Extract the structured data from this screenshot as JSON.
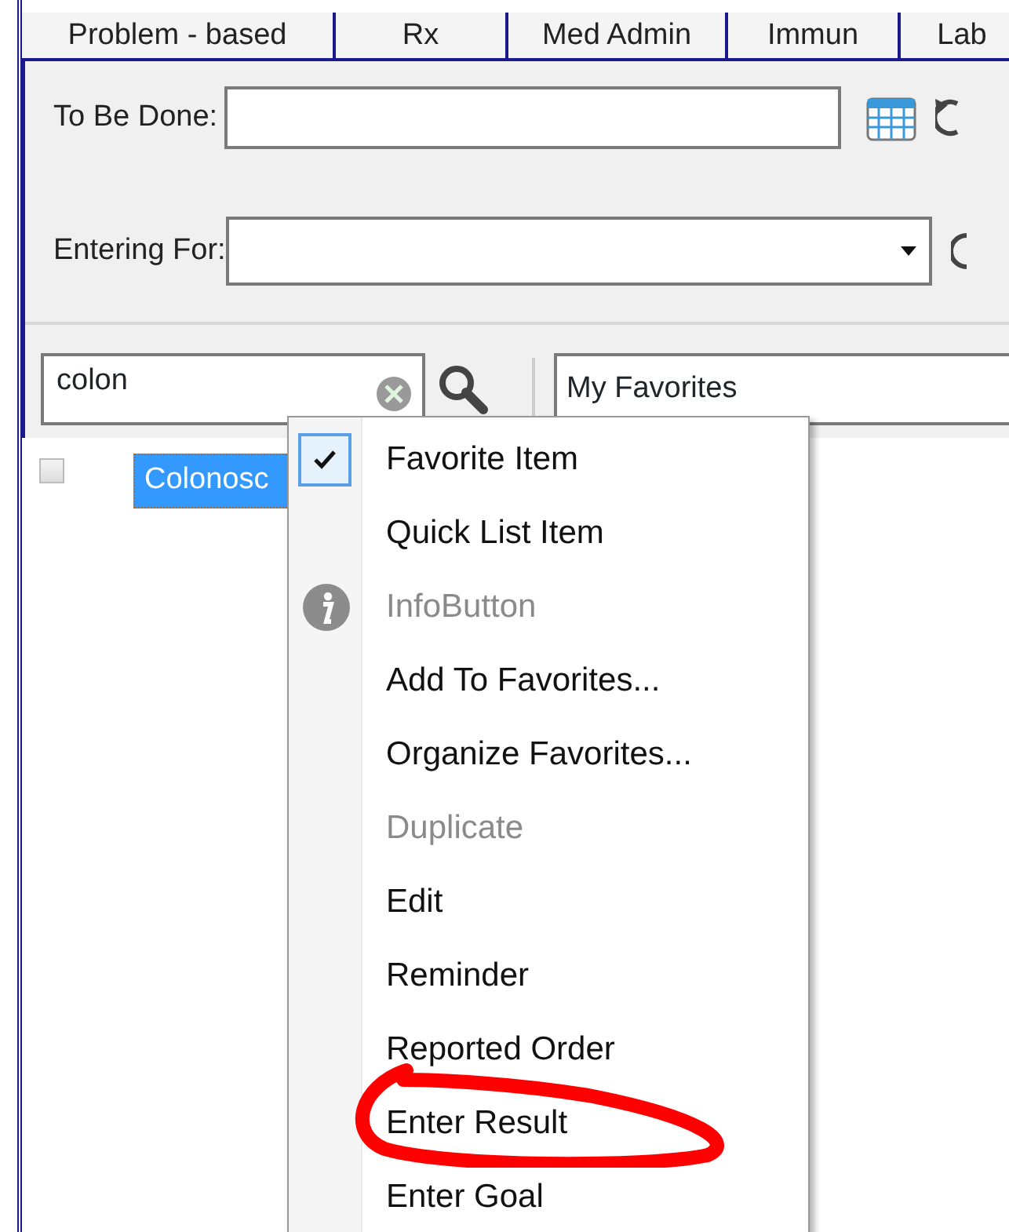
{
  "tabs": [
    {
      "label": "Problem - based",
      "selected": false
    },
    {
      "label": "Rx",
      "selected": false
    },
    {
      "label": "Med Admin",
      "selected": false
    },
    {
      "label": "Immun",
      "selected": false
    },
    {
      "label": "Lab",
      "selected": false
    }
  ],
  "to_be_done": {
    "label": "To Be Done:"
  },
  "entering_for": {
    "label": "Entering For:"
  },
  "search": {
    "value": "colon"
  },
  "list_filter": {
    "value": "My Favorites"
  },
  "results": [
    {
      "label": "Colonosc",
      "checked": false,
      "selected": true
    }
  ],
  "context_menu": [
    {
      "kind": "check",
      "label": "Favorite Item",
      "checked": true,
      "disabled": false
    },
    {
      "kind": "plain",
      "label": "Quick List Item",
      "checked": false,
      "disabled": false
    },
    {
      "kind": "info",
      "label": "InfoButton",
      "checked": false,
      "disabled": true
    },
    {
      "kind": "plain",
      "label": "Add To Favorites...",
      "checked": false,
      "disabled": false
    },
    {
      "kind": "plain",
      "label": "Organize Favorites...",
      "checked": false,
      "disabled": false
    },
    {
      "kind": "plain",
      "label": "Duplicate",
      "checked": false,
      "disabled": true
    },
    {
      "kind": "plain",
      "label": "Edit",
      "checked": false,
      "disabled": false
    },
    {
      "kind": "plain",
      "label": "Reminder",
      "checked": false,
      "disabled": false
    },
    {
      "kind": "plain",
      "label": "Reported Order",
      "checked": false,
      "disabled": false
    },
    {
      "kind": "plain",
      "label": "Enter Result",
      "checked": false,
      "disabled": false
    },
    {
      "kind": "plain",
      "label": "Enter Goal",
      "checked": false,
      "disabled": false
    }
  ]
}
